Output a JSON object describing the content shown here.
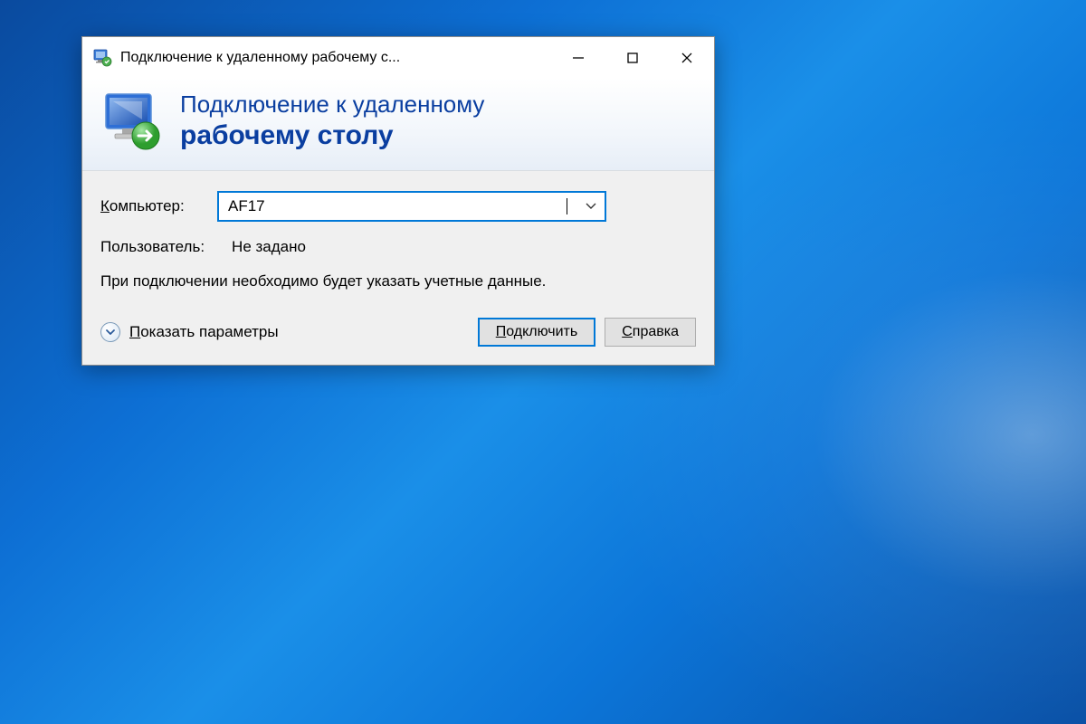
{
  "window": {
    "title": "Подключение к удаленному рабочему с..."
  },
  "header": {
    "line1": "Подключение к удаленному",
    "line2": "рабочему столу"
  },
  "form": {
    "computer_label": "Компьютер:",
    "computer_value": "AF17",
    "user_label": "Пользователь:",
    "user_value": "Не задано",
    "info": "При подключении необходимо будет указать учетные данные."
  },
  "footer": {
    "show_options": "Показать параметры",
    "connect": "Подключить",
    "help": "Справка"
  }
}
